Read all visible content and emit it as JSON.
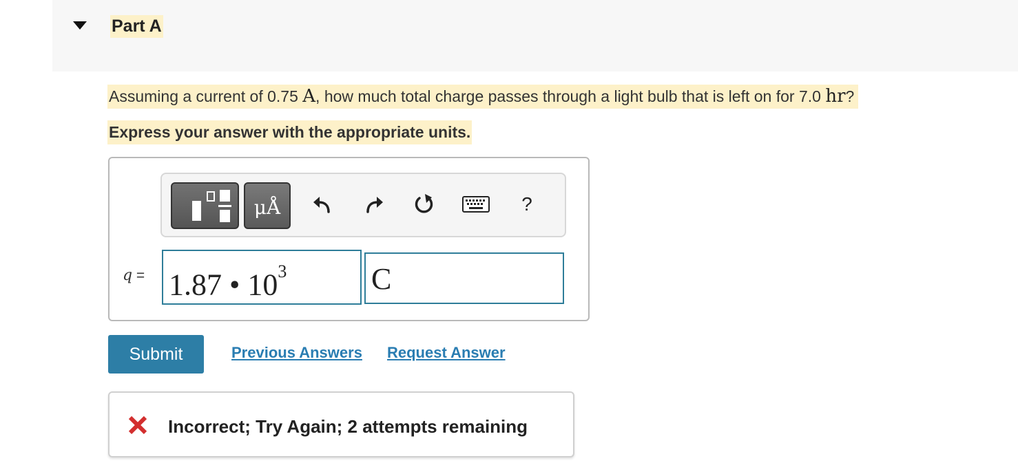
{
  "part": {
    "title": "Part A"
  },
  "question": {
    "text_before": "Assuming a current of 0.75 ",
    "current_unit": "A",
    "text_middle": ", how much total charge passes through a light bulb that is left on for 7.0 ",
    "time_unit": "hr",
    "text_after": "?",
    "instruction": "Express your answer with the appropriate units."
  },
  "toolbar": {
    "units_label": "μÅ",
    "help_label": "?"
  },
  "answer": {
    "variable": "q",
    "equals": " =",
    "value_mantissa": "1.87 • 10",
    "value_exponent": "3",
    "units_value": "C"
  },
  "actions": {
    "submit_label": "Submit",
    "previous_answers_label": "Previous Answers",
    "request_answer_label": "Request Answer"
  },
  "feedback": {
    "message": "Incorrect; Try Again; 2 attempts remaining",
    "icon": "x-icon",
    "color": "#d32f2f"
  },
  "colors": {
    "highlight": "#fdf1c9",
    "accent": "#2d7ea6",
    "link": "#2a7db2",
    "input_border": "#2e7d99"
  }
}
